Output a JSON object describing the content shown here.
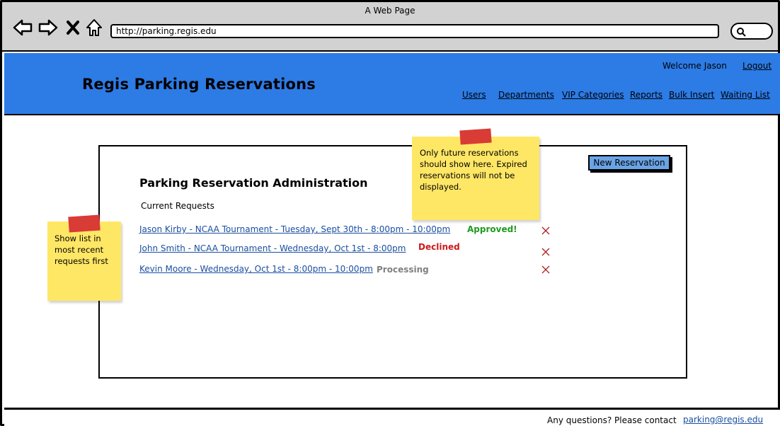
{
  "window": {
    "title": "A Web Page",
    "url": "http://parking.regis.edu"
  },
  "header": {
    "title": "Regis Parking Reservations",
    "welcome": "Welcome Jason",
    "logout": "Logout",
    "nav": [
      "Users",
      "Departments",
      "VIP Categories",
      "Reports",
      "Bulk Insert",
      "Waiting List"
    ]
  },
  "panel": {
    "title": "Parking Reservation Administration",
    "subtitle": "Current Requests",
    "new_button": "New Reservation",
    "requests": [
      {
        "text": "Jason Kirby - NCAA Tournament - Tuesday, Sept 30th - 8:00pm - 10:00pm",
        "status": "Approved!",
        "status_color": "#1f9a1f"
      },
      {
        "text": "John Smith - NCAA Tournament - Wednesday, Oct 1st - 8:00pm ",
        "status": "Declined",
        "status_color": "#cc1a1a"
      },
      {
        "text": "Kevin Moore - Wednesday, Oct 1st - 8:00pm - 10:00pm",
        "status": "Processing",
        "status_color": "#808080"
      }
    ]
  },
  "notes": {
    "left": "Show list in most recent requests first",
    "right": "Only future reservations should show here. Expired reservations will not be displayed."
  },
  "footer": {
    "text": "Any questions? Please contact",
    "email": "parking@regis.edu"
  },
  "colors": {
    "header_bg": "#2d7be5",
    "button_bg": "#6aa4e6",
    "sticky": "#ffe766",
    "tape": "#d93b35"
  }
}
